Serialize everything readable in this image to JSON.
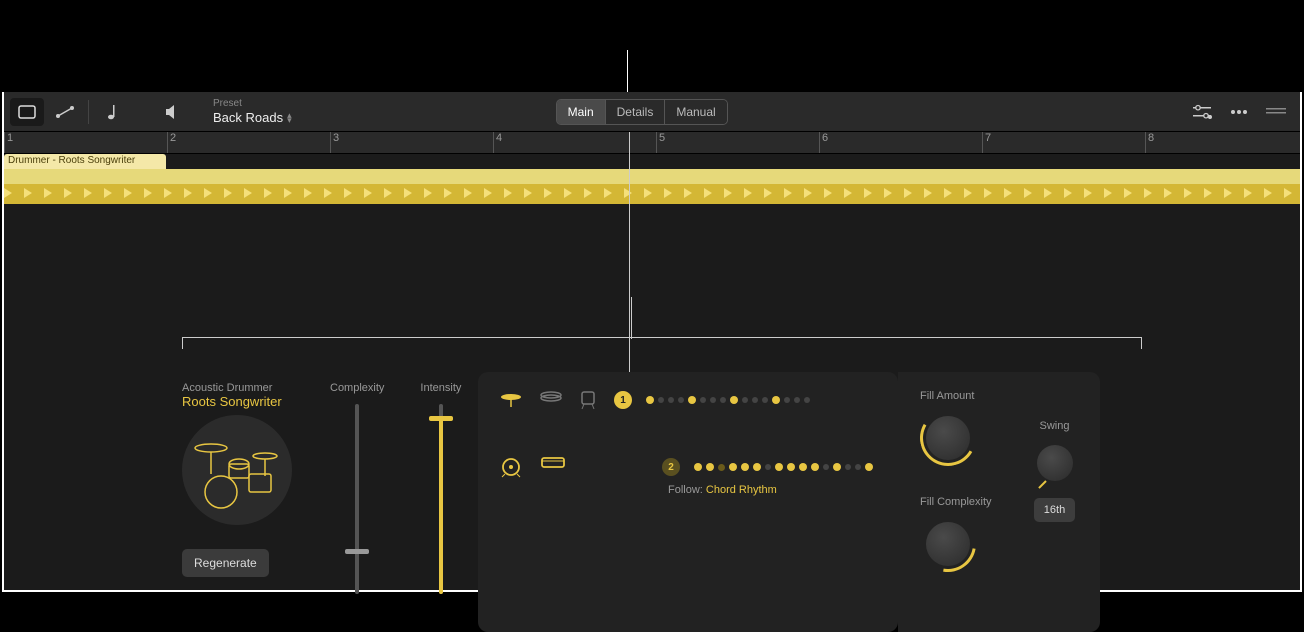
{
  "toolbar": {
    "preset_label": "Preset",
    "preset_name": "Back Roads"
  },
  "tabs": {
    "main": "Main",
    "details": "Details",
    "manual": "Manual",
    "active": "Main"
  },
  "ruler": {
    "marks": [
      "1",
      "2",
      "3",
      "4",
      "5",
      "6",
      "7",
      "8"
    ]
  },
  "region": {
    "label": "Drummer - Roots Songwriter"
  },
  "drummer": {
    "type": "Acoustic Drummer",
    "name": "Roots Songwriter",
    "regenerate": "Regenerate"
  },
  "sliders": {
    "complexity_label": "Complexity",
    "intensity_label": "Intensity"
  },
  "patterns": {
    "row1_badge": "1",
    "row2_badge": "2",
    "follow_label": "Follow:",
    "follow_value": "Chord Rhythm"
  },
  "knobs": {
    "fill_amount": "Fill Amount",
    "fill_complexity": "Fill Complexity",
    "swing": "Swing",
    "swing_mode": "16th"
  },
  "colors": {
    "accent": "#e8c642"
  }
}
